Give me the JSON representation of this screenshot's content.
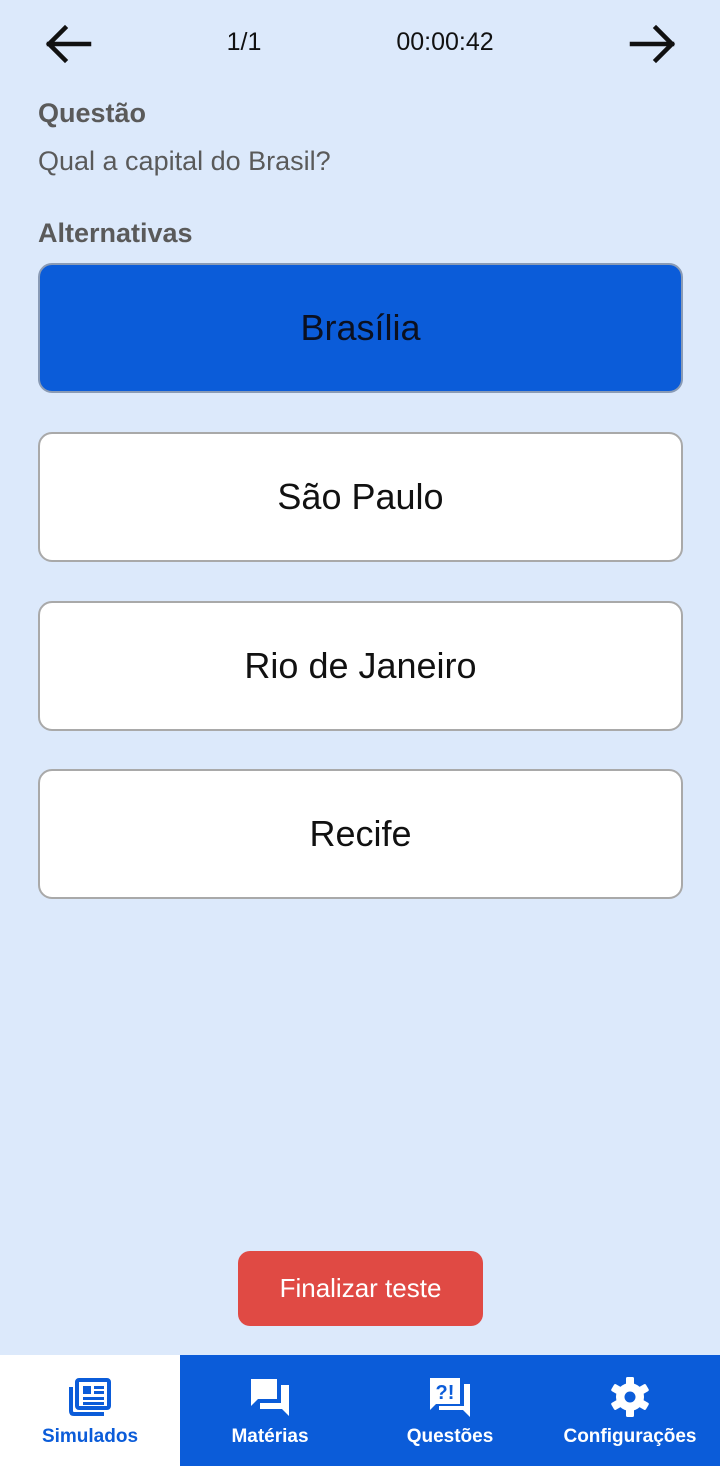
{
  "header": {
    "progress": "1/1",
    "timer": "00:00:42"
  },
  "question": {
    "label": "Questão",
    "text": "Qual a capital do Brasil?"
  },
  "alternatives": {
    "label": "Alternativas",
    "options": [
      {
        "text": "Brasília",
        "selected": true
      },
      {
        "text": "São Paulo",
        "selected": false
      },
      {
        "text": "Rio de Janeiro",
        "selected": false
      },
      {
        "text": "Recife",
        "selected": false
      }
    ]
  },
  "finish_button": "Finalizar teste",
  "bottom_nav": {
    "tabs": [
      {
        "label": "Simulados",
        "icon": "newspaper-icon",
        "active": true
      },
      {
        "label": "Matérias",
        "icon": "forum-icon",
        "active": false
      },
      {
        "label": "Questões",
        "icon": "quiz-icon",
        "active": false
      },
      {
        "label": "Configurações",
        "icon": "gear-icon",
        "active": false
      }
    ]
  },
  "colors": {
    "background": "#dce9fb",
    "primary": "#0b5cd9",
    "danger": "#e04a44"
  }
}
